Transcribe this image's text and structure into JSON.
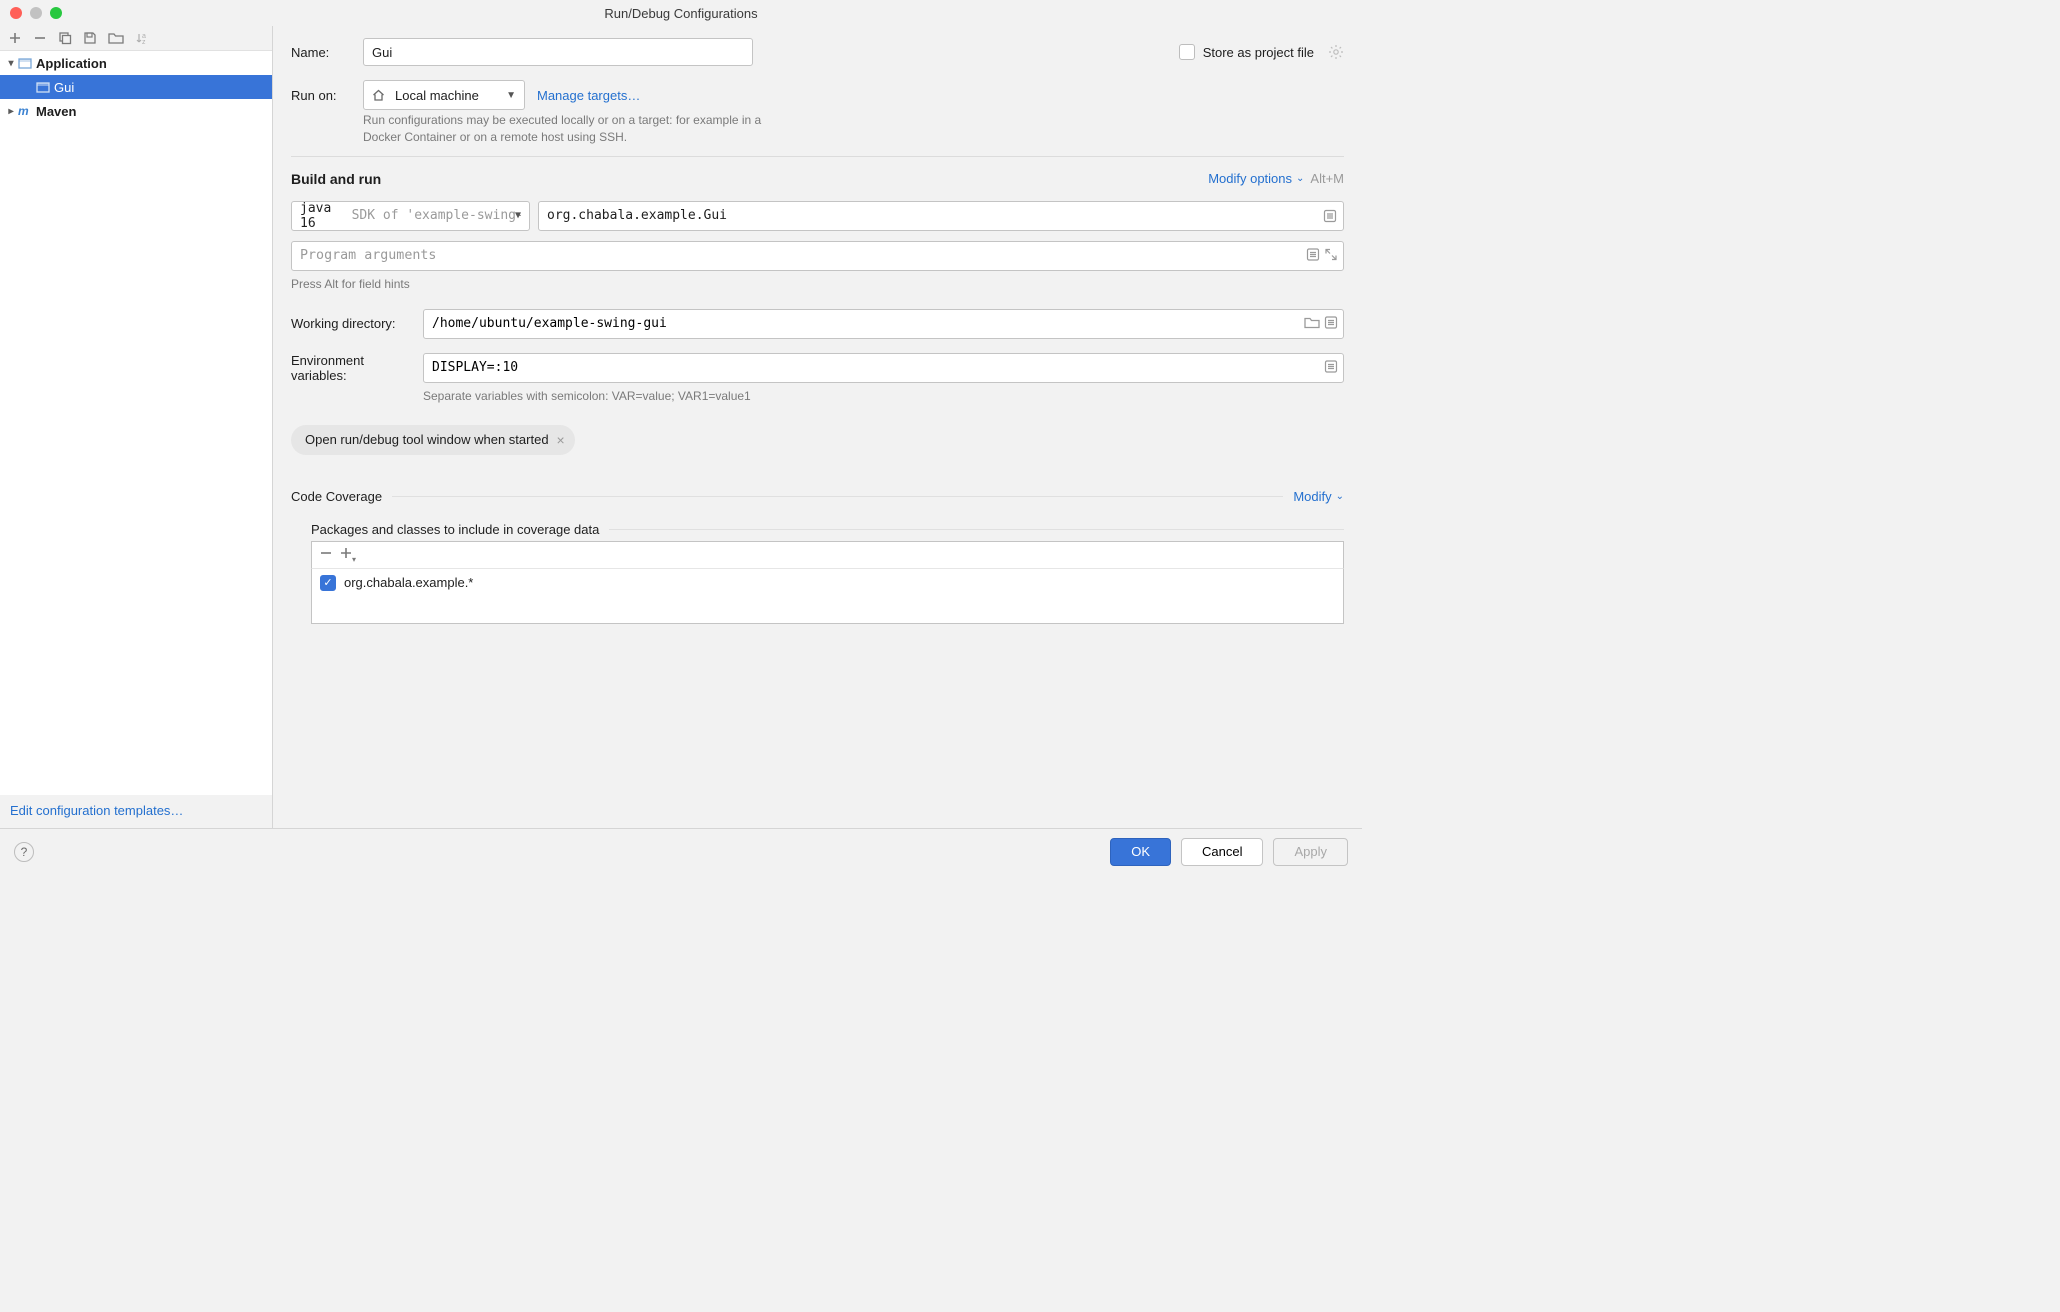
{
  "window": {
    "title": "Run/Debug Configurations"
  },
  "tree": {
    "application": {
      "label": "Application",
      "child": "Gui"
    },
    "maven": {
      "label": "Maven"
    }
  },
  "sidebar": {
    "editTemplates": "Edit configuration templates…"
  },
  "form": {
    "nameLabel": "Name:",
    "nameValue": "Gui",
    "storeAsProject": "Store as project file",
    "runOnLabel": "Run on:",
    "runOnValue": "Local machine",
    "manageTargets": "Manage targets…",
    "runOnHint": "Run configurations may be executed locally or on a target: for example in a Docker Container or on a remote host using SSH.",
    "buildAndRun": "Build and run",
    "modifyOptions": "Modify options",
    "modifyShortcut": "Alt+M",
    "jdk": "java 16",
    "jdkSuffix": "SDK of 'example-swing-gui'",
    "mainClass": "org.chabala.example.Gui",
    "programArgsPlaceholder": "Program arguments",
    "pressAltHint": "Press Alt for field hints",
    "workingDirLabel": "Working directory:",
    "workingDirValue": "/home/ubuntu/example-swing-gui",
    "envLabel": "Environment variables:",
    "envValue": "DISPLAY=:10",
    "envHint": "Separate variables with semicolon: VAR=value; VAR1=value1",
    "chip": "Open run/debug tool window when started",
    "codeCoverage": "Code Coverage",
    "modify": "Modify",
    "packagesTitle": "Packages and classes to include in coverage data",
    "packageEntry": "org.chabala.example.*"
  },
  "footer": {
    "ok": "OK",
    "cancel": "Cancel",
    "apply": "Apply"
  }
}
